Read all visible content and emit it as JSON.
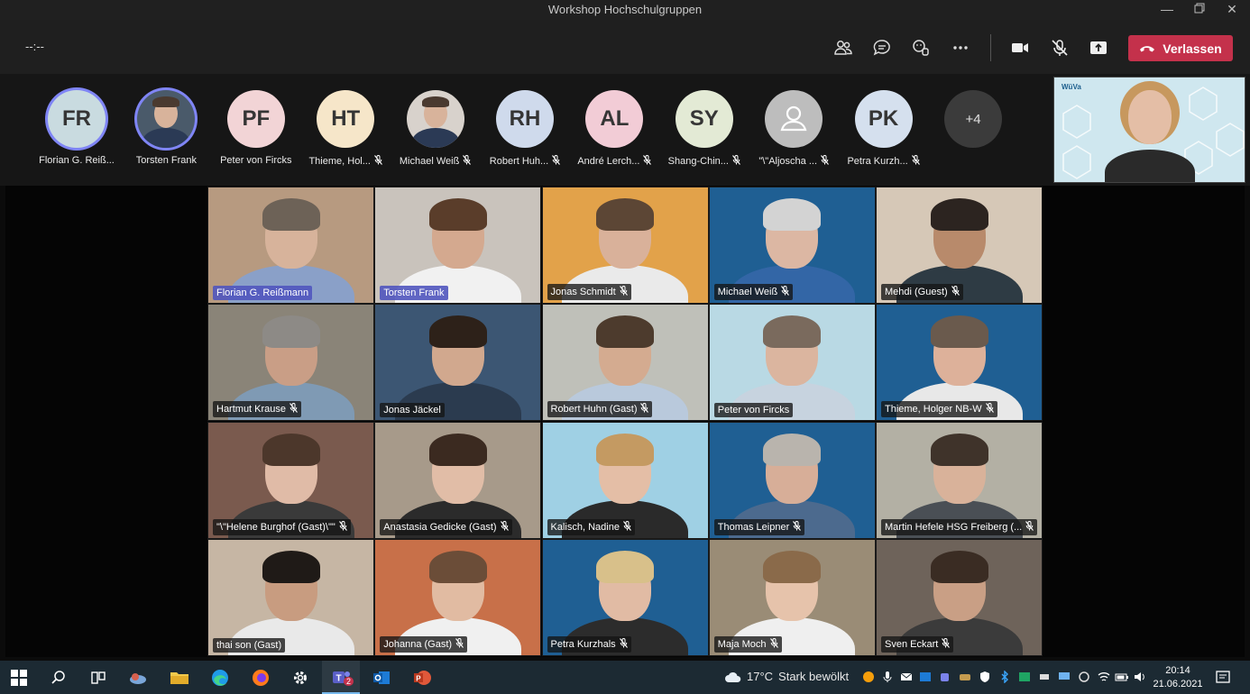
{
  "window": {
    "title": "Workshop Hochschulgruppen"
  },
  "toolbar": {
    "timer": "--:--",
    "leave_label": "Verlassen"
  },
  "strip": {
    "participants": [
      {
        "initials": "FR",
        "name": "Florian G. Reiß...",
        "bg": "#c9dbe0",
        "muted": false,
        "ring": true,
        "photo": false
      },
      {
        "initials": "",
        "name": "Torsten Frank",
        "bg": "#4a5a6a",
        "muted": false,
        "ring": true,
        "photo": true
      },
      {
        "initials": "PF",
        "name": "Peter von Fircks",
        "bg": "#f2d4d6",
        "muted": false,
        "ring": false,
        "photo": false
      },
      {
        "initials": "HT",
        "name": "Thieme, Hol...",
        "bg": "#f6e6c9",
        "muted": true,
        "ring": false,
        "photo": false
      },
      {
        "initials": "",
        "name": "Michael Weiß",
        "bg": "#d8d2cc",
        "muted": true,
        "ring": false,
        "photo": true
      },
      {
        "initials": "RH",
        "name": "Robert Huh...",
        "bg": "#cfdaec",
        "muted": true,
        "ring": false,
        "photo": false
      },
      {
        "initials": "AL",
        "name": "André Lerch...",
        "bg": "#f2ccd6",
        "muted": true,
        "ring": false,
        "photo": false
      },
      {
        "initials": "SY",
        "name": "Shang-Chin...",
        "bg": "#e3ead5",
        "muted": true,
        "ring": false,
        "photo": false
      },
      {
        "initials": "",
        "name": "\"\\\"Aljoscha ...",
        "bg": "#bdbdbd",
        "muted": true,
        "ring": false,
        "photo": false
      },
      {
        "initials": "PK",
        "name": "Petra Kurzh...",
        "bg": "#d5e0ee",
        "muted": true,
        "ring": false,
        "photo": false
      }
    ],
    "more_label": "+4"
  },
  "selfview": {
    "brand": "WüVa"
  },
  "tiles": [
    {
      "name": "Florian G. Reißmann",
      "muted": false,
      "active": true,
      "bg": "#b79a80",
      "skin": "#d7b39b",
      "hair": "#6d6257",
      "shirt": "#8aa0c8"
    },
    {
      "name": "Torsten Frank",
      "muted": false,
      "active": true,
      "bg": "#c9c3bc",
      "skin": "#d4a98f",
      "hair": "#5a3d2a",
      "shirt": "#f1f1f1"
    },
    {
      "name": "Jonas Schmidt",
      "muted": true,
      "active": false,
      "bg": "#e2a24a",
      "skin": "#d9b19a",
      "hair": "#5c4635",
      "shirt": "#eaeaea"
    },
    {
      "name": "Michael Weiß",
      "muted": true,
      "active": false,
      "bg": "#1f5f93",
      "skin": "#dcb7a3",
      "hair": "#d3d3d3",
      "shirt": "#3366a6"
    },
    {
      "name": "Mehdi (Guest)",
      "muted": true,
      "active": false,
      "bg": "#d6c8b7",
      "skin": "#b88a6b",
      "hair": "#2c2420",
      "shirt": "#2e3b44"
    },
    {
      "name": "Hartmut Krause",
      "muted": true,
      "active": false,
      "bg": "#8a8478",
      "skin": "#c99e86",
      "hair": "#8d8a86",
      "shirt": "#7f9ab4"
    },
    {
      "name": "Jonas Jäckel",
      "muted": false,
      "active": false,
      "bg": "#3c5673",
      "skin": "#d1a88e",
      "hair": "#2d2119",
      "shirt": "#2b3b4f"
    },
    {
      "name": "Robert Huhn (Gast)",
      "muted": true,
      "active": false,
      "bg": "#bfc0b9",
      "skin": "#d4ab90",
      "hair": "#4d3b2d",
      "shirt": "#b9c9dc"
    },
    {
      "name": "Peter von Fircks",
      "muted": false,
      "active": false,
      "bg": "#b9d9e4",
      "skin": "#dbb59f",
      "hair": "#7a6a5d",
      "shirt": "#c7d3df"
    },
    {
      "name": "Thieme, Holger NB-W",
      "muted": true,
      "active": false,
      "bg": "#1f5f93",
      "skin": "#ddb19a",
      "hair": "#6a5a4d",
      "shirt": "#e8e8e8"
    },
    {
      "name": "\"\\\"Helene Burghof (Gast)\\\"\"",
      "muted": true,
      "active": false,
      "bg": "#7a5a4e",
      "skin": "#e0bba7",
      "hair": "#4c372b",
      "shirt": "#3a3a3a"
    },
    {
      "name": "Anastasia Gedicke (Gast)",
      "muted": true,
      "active": false,
      "bg": "#a79a8a",
      "skin": "#e1bda7",
      "hair": "#3b2a20",
      "shirt": "#2b2b2b"
    },
    {
      "name": "Kalisch, Nadine",
      "muted": true,
      "active": false,
      "bg": "#9fd0e4",
      "skin": "#e4bea6",
      "hair": "#c49a62",
      "shirt": "#2a2a2a"
    },
    {
      "name": "Thomas Leipner",
      "muted": true,
      "active": false,
      "bg": "#1f5f93",
      "skin": "#d7ae98",
      "hair": "#b9b4ad",
      "shirt": "#4c6a8e"
    },
    {
      "name": "Martin Hefele HSG Freiberg (...",
      "muted": true,
      "active": false,
      "bg": "#b3b0a4",
      "skin": "#d9b29a",
      "hair": "#3f332a",
      "shirt": "#4a4f55"
    },
    {
      "name": "thai son (Gast)",
      "muted": false,
      "active": false,
      "bg": "#c6b6a4",
      "skin": "#c89c80",
      "hair": "#1f1a17",
      "shirt": "#e9e9e9"
    },
    {
      "name": "Johanna (Gast)",
      "muted": true,
      "active": false,
      "bg": "#c87049",
      "skin": "#e1bba2",
      "hair": "#6b4d38",
      "shirt": "#f0f0f0"
    },
    {
      "name": "Petra Kurzhals",
      "muted": true,
      "active": false,
      "bg": "#1f5f93",
      "skin": "#e1bba4",
      "hair": "#d8c08a",
      "shirt": "#2c2c2c"
    },
    {
      "name": "Maja Moch",
      "muted": true,
      "active": false,
      "bg": "#9a8c76",
      "skin": "#e6c3ab",
      "hair": "#8a6a4a",
      "shirt": "#efefef"
    },
    {
      "name": "Sven Eckart",
      "muted": true,
      "active": false,
      "bg": "#6e635a",
      "skin": "#c99f85",
      "hair": "#3a2c23",
      "shirt": "#3b3b3b"
    }
  ],
  "taskbar": {
    "weather_temp": "17°C",
    "weather_text": "Stark bewölkt",
    "time": "20:14",
    "date": "21.06.2021",
    "teams_badge": "2"
  },
  "colors": {
    "accent": "#7f85f5",
    "leave": "#c4314b",
    "taskbar": "#1c2a33"
  }
}
